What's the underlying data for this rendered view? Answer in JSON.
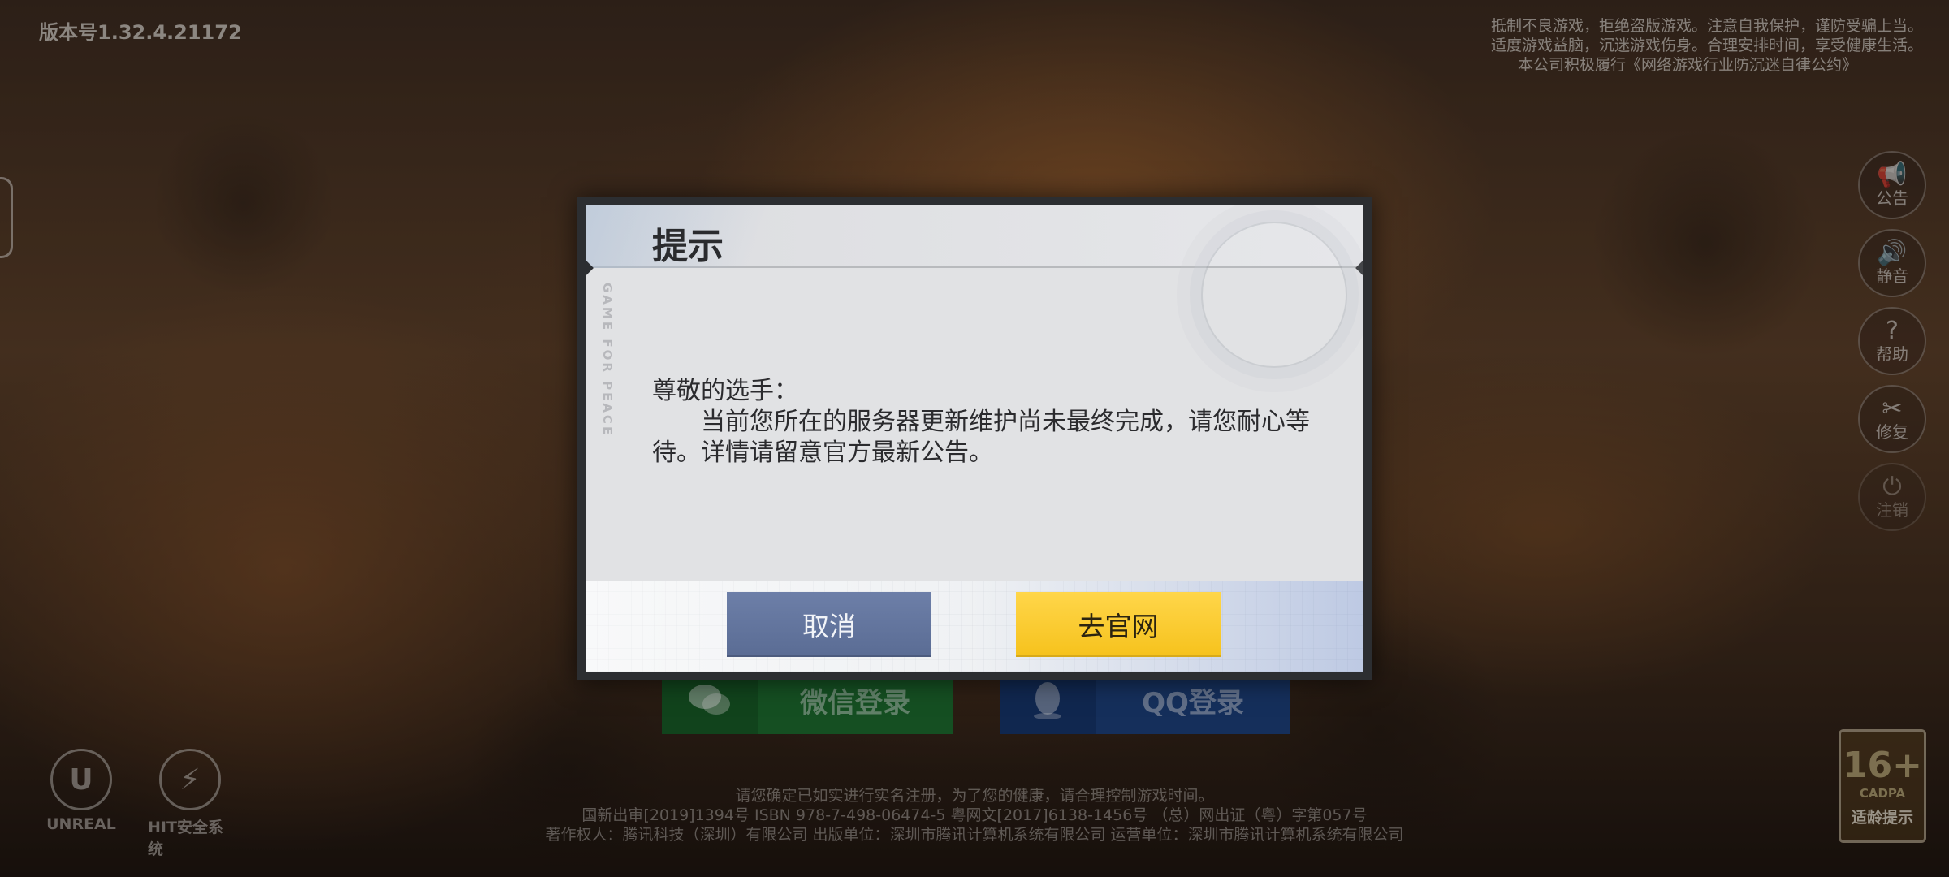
{
  "version": "版本号1.32.4.21172",
  "health_notice": [
    "抵制不良游戏，拒绝盗版游戏。注意自我保护，谨防受骗上当。",
    "适度游戏益脑，沉迷游戏伤身。合理安排时间，享受健康生活。",
    "本公司积极履行《网络游戏行业防沉迷自律公约》"
  ],
  "side_menu": [
    {
      "icon": "megaphone-icon",
      "glyph": "📢",
      "label": "公告"
    },
    {
      "icon": "speaker-icon",
      "glyph": "🔊",
      "label": "静音"
    },
    {
      "icon": "question-icon",
      "glyph": "?",
      "label": "帮助"
    },
    {
      "icon": "wrench-icon",
      "glyph": "✂",
      "label": "修复"
    },
    {
      "icon": "power-icon",
      "glyph": "⏻",
      "label": "注销"
    }
  ],
  "login": {
    "wechat_label": "微信登录",
    "qq_label": "QQ登录"
  },
  "footer": {
    "line1": "请您确定已如实进行实名注册，为了您的健康，请合理控制游戏时间。",
    "line2": "国新出审[2019]1394号  ISBN 978-7-498-06474-5  粤网文[2017]6138-1456号 （总）网出证（粤）字第057号",
    "line3": "著作权人：腾讯科技（深圳）有限公司   出版单位：深圳市腾讯计算机系统有限公司   运营单位：深圳市腾讯计算机系统有限公司"
  },
  "engines": {
    "unreal": "UNREAL",
    "hit": "HIT安全系统"
  },
  "age_rating": {
    "value": "16+",
    "org": "CADPA",
    "label": "适龄提示"
  },
  "dialog": {
    "title": "提示",
    "side_text": "GAME FOR PEACE",
    "greeting": "尊敬的选手：",
    "message": "当前您所在的服务器更新维护尚未最终完成，请您耐心等待。详情请留意官方最新公告。",
    "cancel_label": "取消",
    "website_label": "去官网"
  },
  "colors": {
    "cancel_button": "#5f7199",
    "website_button": "#f8c827",
    "dialog_bg": "#e1e2e4",
    "dialog_frame": "#2c2e31"
  }
}
